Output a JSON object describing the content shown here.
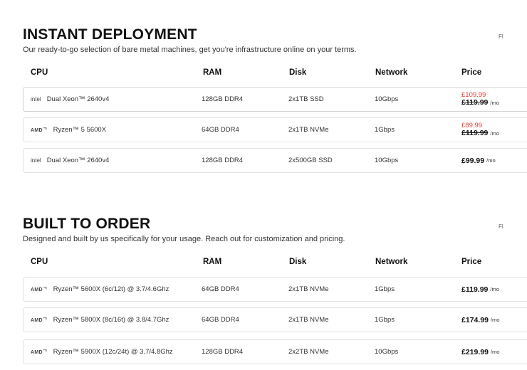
{
  "instant": {
    "title": "INSTANT DEPLOYMENT",
    "subtitle": "Our ready-to-go selection of bare metal machines, get you're infrastructure online on your terms.",
    "side_label": "Fl",
    "headers": {
      "cpu": "CPU",
      "ram": "RAM",
      "disk": "Disk",
      "network": "Network",
      "price": "Price"
    },
    "rows": [
      {
        "brand": "intel",
        "cpu": "Dual Xeon™ 2640v4",
        "ram": "128GB DDR4",
        "disk": "2x1TB SSD",
        "network": "10Gbps",
        "sale_price": "£109.99",
        "old_price": "£119.99",
        "unit": "/mo"
      },
      {
        "brand": "AMDᄀ",
        "cpu": "Ryzen™ 5 5600X",
        "ram": "64GB DDR4",
        "disk": "2x1TB NVMe",
        "network": "1Gbps",
        "sale_price": "£89.99",
        "old_price": "£119.99",
        "unit": "/mo"
      },
      {
        "brand": "intel",
        "cpu": "Dual Xeon™ 2640v4",
        "ram": "128GB DDR4",
        "disk": "2x500GB SSD",
        "network": "10Gbps",
        "price": "£99.99",
        "unit": "/mo"
      }
    ]
  },
  "built": {
    "title": "BUILT TO ORDER",
    "subtitle": "Designed and built by us specifically for your usage. Reach out for customization and pricing.",
    "side_label": "Fl",
    "headers": {
      "cpu": "CPU",
      "ram": "RAM",
      "disk": "Disk",
      "network": "Network",
      "price": "Price"
    },
    "rows": [
      {
        "brand": "AMDᄀ",
        "cpu": "Ryzen™ 5600X (6c/12t) @ 3.7/4.6Ghz",
        "ram": "64GB DDR4",
        "disk": "2x1TB NVMe",
        "network": "1Gbps",
        "price": "£119.99",
        "unit": "/mo"
      },
      {
        "brand": "AMDᄀ",
        "cpu": "Ryzen™ 5800X (8c/16t) @ 3.8/4.7Ghz",
        "ram": "64GB DDR4",
        "disk": "2x1TB NVMe",
        "network": "1Gbps",
        "price": "£174.99",
        "unit": "/mo"
      },
      {
        "brand": "AMDᄀ",
        "cpu": "Ryzen™ 5900X (12c/24t) @ 3.7/4.8Ghz",
        "ram": "128GB DDR4",
        "disk": "2x2TB NVMe",
        "network": "10Gbps",
        "price": "£219.99",
        "unit": "/mo"
      }
    ]
  },
  "colors": {
    "sale": "#e0403a",
    "text": "#111111",
    "border": "#e2e2e2"
  }
}
